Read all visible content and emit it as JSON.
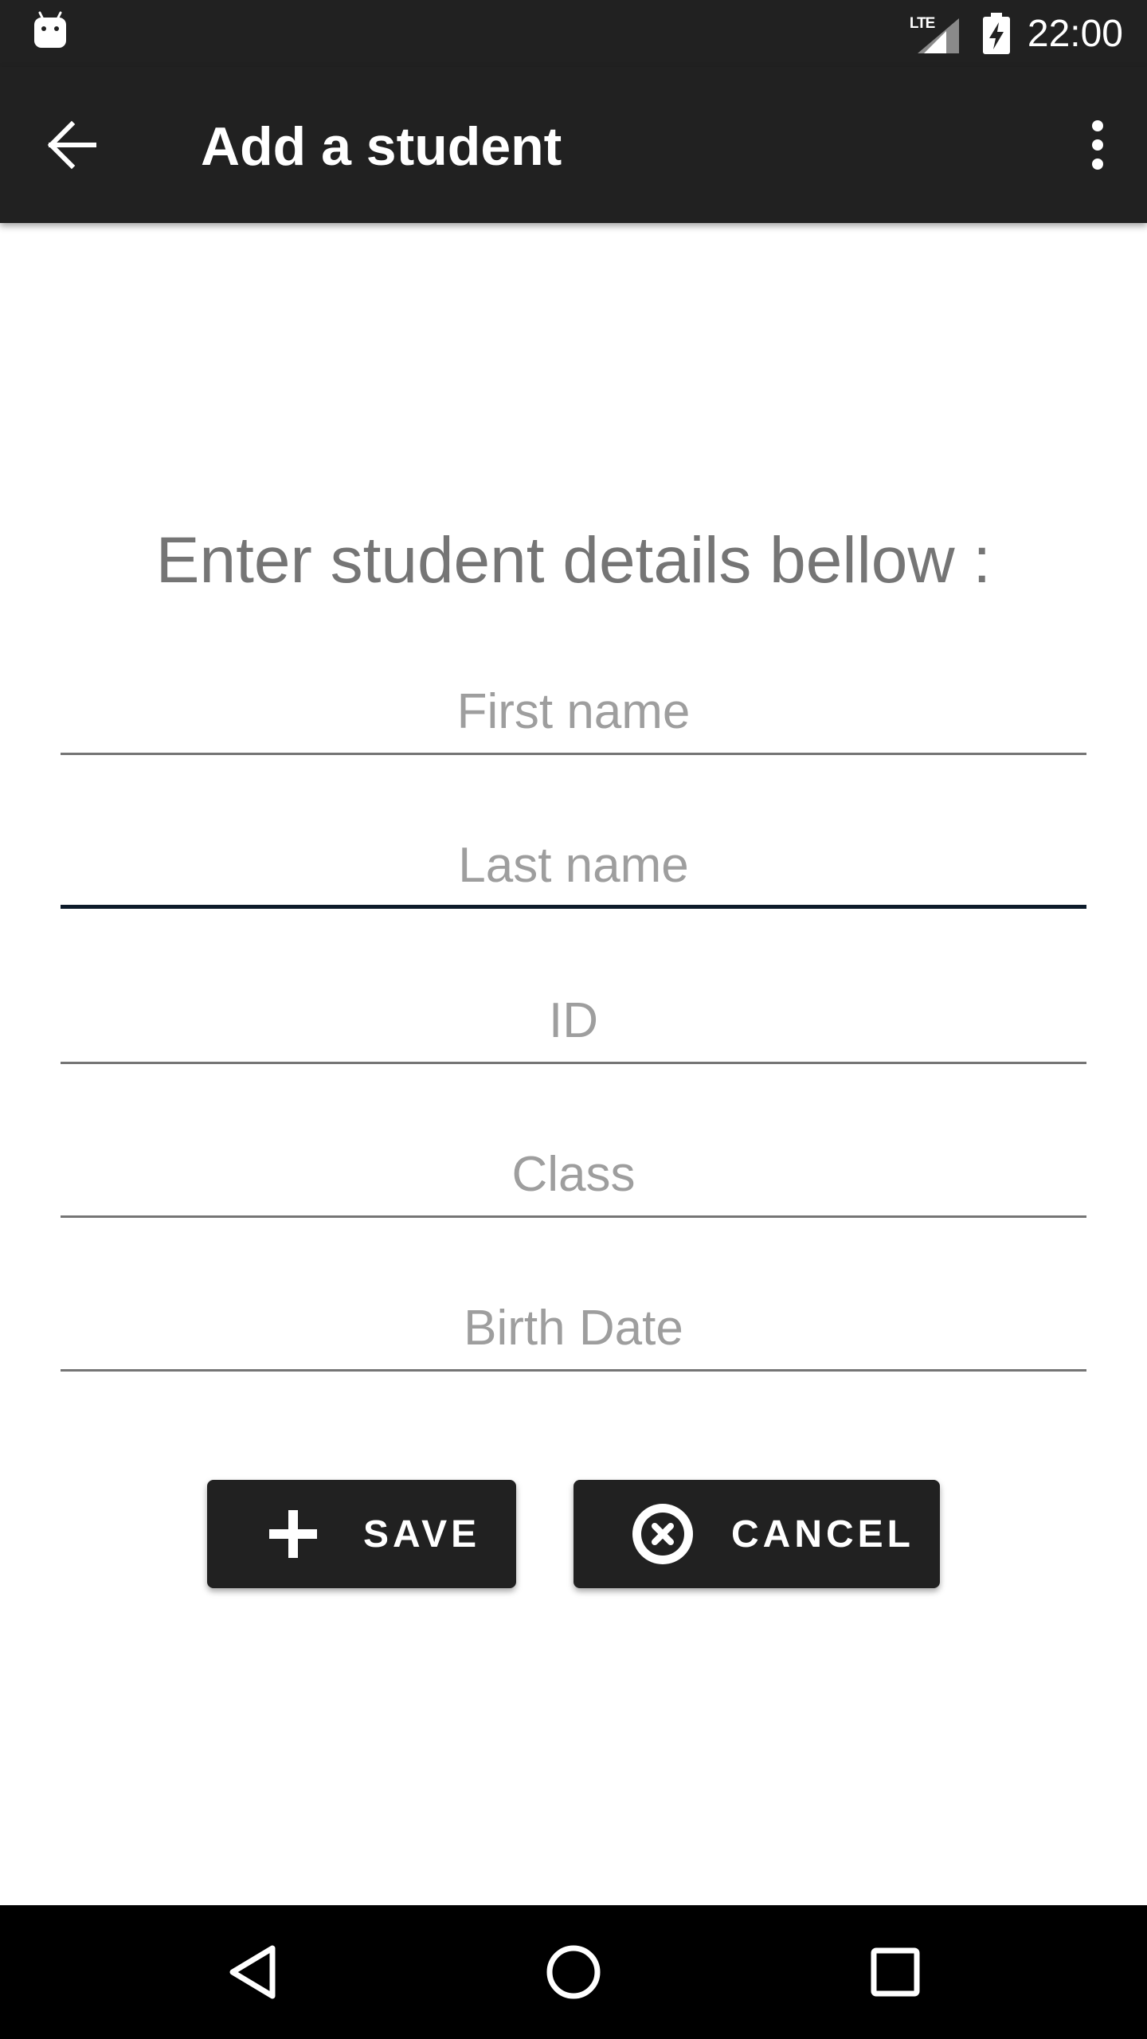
{
  "status_bar": {
    "time": "22:00",
    "network_label": "LTE",
    "icons": [
      "android-icon",
      "lte-signal-icon",
      "battery-charging-icon"
    ]
  },
  "app_bar": {
    "title": "Add a student",
    "icons": [
      "back-arrow-icon",
      "more-vert-icon"
    ]
  },
  "form": {
    "instructions": "Enter student details bellow :",
    "fields": [
      {
        "placeholder": "First name",
        "value": "",
        "focused": false
      },
      {
        "placeholder": "Last name",
        "value": "",
        "focused": true
      },
      {
        "placeholder": "ID",
        "value": "",
        "focused": false
      },
      {
        "placeholder": "Class",
        "value": "",
        "focused": false
      },
      {
        "placeholder": "Birth Date",
        "value": "",
        "focused": false
      }
    ]
  },
  "buttons": {
    "save_label": "SAVE",
    "save_icon": "plus-icon",
    "cancel_label": "CANCEL",
    "cancel_icon": "cancel-circle-icon"
  },
  "nav_bar": {
    "icons": [
      "nav-back-icon",
      "nav-home-icon",
      "nav-recents-icon"
    ]
  },
  "colors": {
    "bar_background": "#212121",
    "button_background": "#212121",
    "focused_underline": "#0d1b2a",
    "placeholder": "#9e9e9e",
    "instructions_text": "#757575"
  }
}
